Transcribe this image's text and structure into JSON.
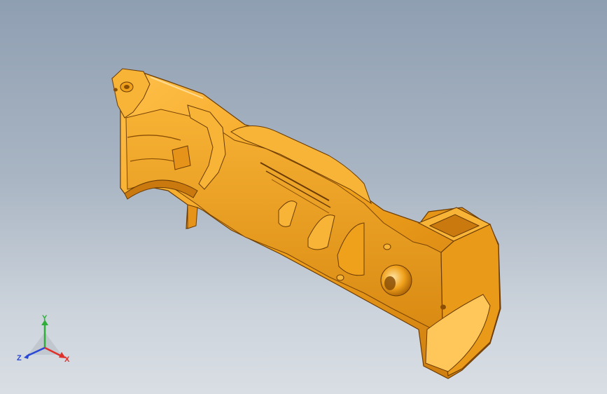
{
  "viewport": {
    "background_top": "#8f9fb2",
    "background_bottom": "#d9dee4"
  },
  "model": {
    "part": "housing-half",
    "body_color": "#f0a11b",
    "shade_color": "#c9790e",
    "dark_color": "#8a4f05",
    "highlight_color": "#ffd27a"
  },
  "triad": {
    "x_label": "X",
    "y_label": "Y",
    "z_label": "Z",
    "x_color": "#e0302a",
    "y_color": "#2fae3a",
    "z_color": "#2a48d8"
  }
}
